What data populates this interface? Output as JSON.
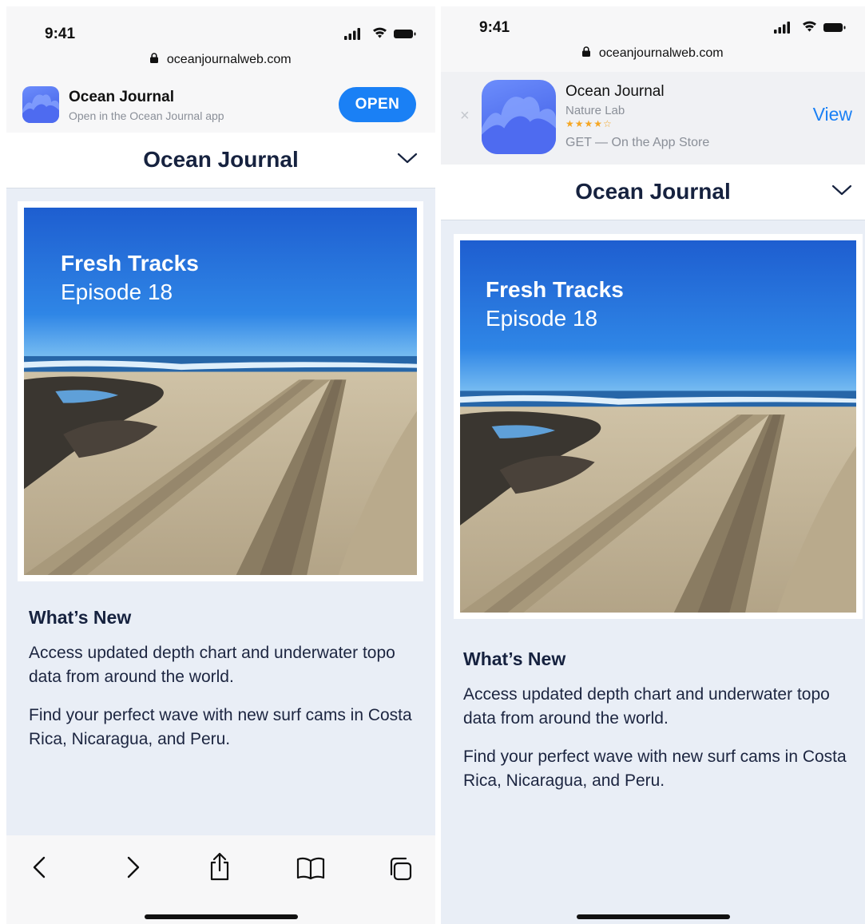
{
  "screens": {
    "left": {
      "status": {
        "time": "9:41"
      },
      "url": "oceanjournalweb.com",
      "banner": {
        "app_name": "Ocean Journal",
        "subtitle": "Open in the Ocean Journal app",
        "open_label": "OPEN"
      },
      "nav": {
        "title": "Ocean Journal"
      },
      "cover": {
        "title": "Fresh Tracks",
        "episode": "Episode 18"
      },
      "whats_new": {
        "heading": "What’s New",
        "paragraphs": [
          "Access updated depth chart and underwater topo data from around the world.",
          "Find your perfect wave with new surf cams in Costa Rica, Nicaragua, and Peru."
        ]
      },
      "toolbar": [
        "back-icon",
        "forward-icon",
        "share-icon",
        "bookmarks-icon",
        "tabs-icon"
      ]
    },
    "right": {
      "status": {
        "time": "9:41"
      },
      "url": "oceanjournalweb.com",
      "banner": {
        "app_name": "Ocean Journal",
        "developer": "Nature Lab",
        "rating_stars": "★★★★☆",
        "rating": 4.5,
        "store_text": "GET — On the App Store",
        "view_label": "View",
        "close_glyph": "×"
      },
      "nav": {
        "title": "Ocean Journal"
      },
      "cover": {
        "title": "Fresh Tracks",
        "episode": "Episode 18"
      },
      "whats_new": {
        "heading": "What’s New",
        "paragraphs": [
          "Access updated depth chart and underwater topo data from around the world.",
          "Find your perfect wave with new surf cams in Costa Rica, Nicaragua, and Peru."
        ]
      }
    }
  },
  "colors": {
    "accent": "#1a80f5",
    "navy": "#16223f",
    "page_bg": "#e9eef6",
    "star": "#f5a623"
  }
}
